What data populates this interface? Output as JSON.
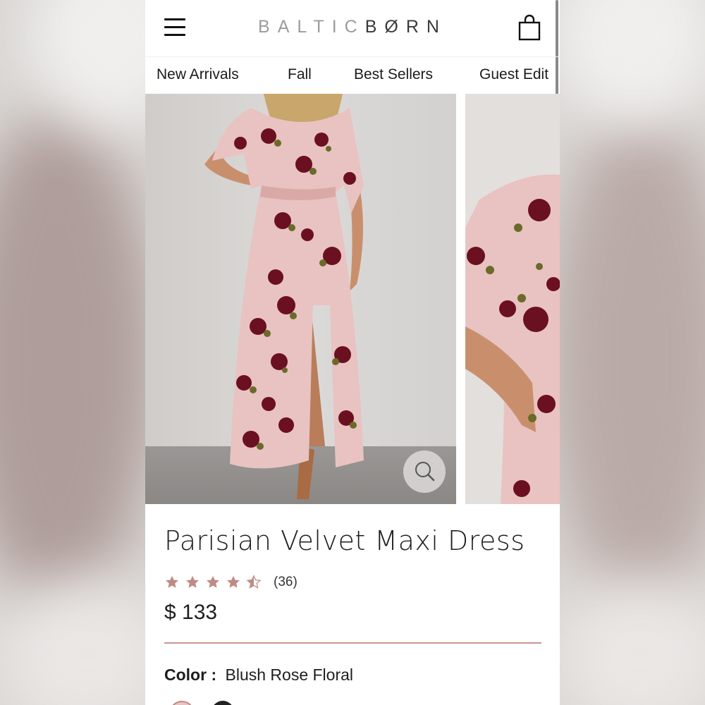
{
  "header": {
    "logo_light": "BALTIC",
    "logo_dark": "BØRN"
  },
  "nav": [
    "New Arrivals",
    "Fall",
    "Best Sellers",
    "Guest Edit"
  ],
  "product": {
    "title": "Parisian Velvet Maxi Dress",
    "rating": 4.5,
    "review_count": "(36)",
    "price": "$ 133",
    "color_label": "Color :",
    "color_value": "Blush Rose Floral"
  },
  "colors": {
    "accent": "#c9968d",
    "star": "#c08b86",
    "dress": "#e9c4c3",
    "rose": "#6b1020"
  }
}
